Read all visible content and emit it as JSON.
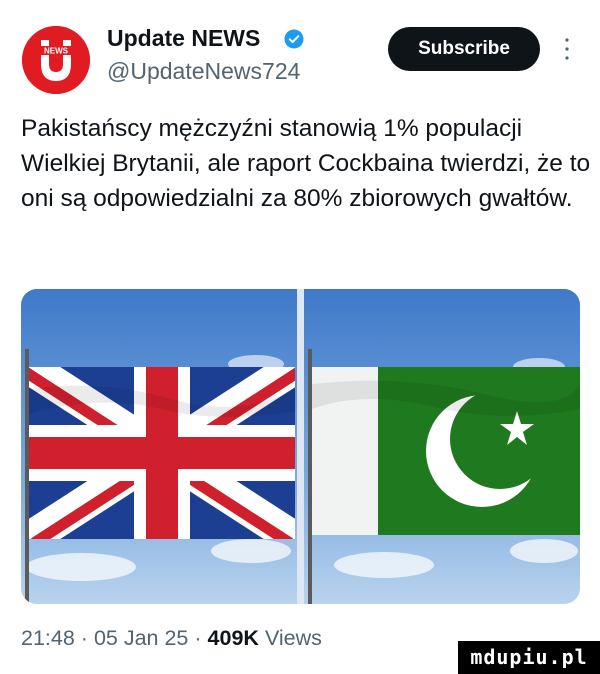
{
  "author": {
    "avatar_text": "NEWS",
    "display_name": "Update NEWS",
    "handle": "@UpdateNews724",
    "verified": true
  },
  "actions": {
    "subscribe_label": "Subscribe",
    "more_icon": "more-vertical-icon"
  },
  "tweet": {
    "text": "Pakistańscy mężczyźni stanowią 1% populacji Wielkiej Brytanii, ale raport Cockbaina twierdzi, że to oni są odpowiedzialni za 80% zbiorowych gwałtów.",
    "media": [
      {
        "subject": "uk-flag"
      },
      {
        "subject": "pakistan-flag"
      }
    ]
  },
  "meta": {
    "time": "21:48",
    "separator": "·",
    "date": "05 Jan 25",
    "views_count": "409K",
    "views_label": "Views"
  },
  "watermark": {
    "text": "mdupiu.pl"
  },
  "colors": {
    "avatar_red": "#e01b22",
    "verified_blue": "#1d9bf0",
    "button_black": "#0f1419",
    "secondary_text": "#536471",
    "uk_blue": "#1c3f94",
    "uk_red": "#d0202e",
    "pk_green": "#1f7a1f"
  }
}
